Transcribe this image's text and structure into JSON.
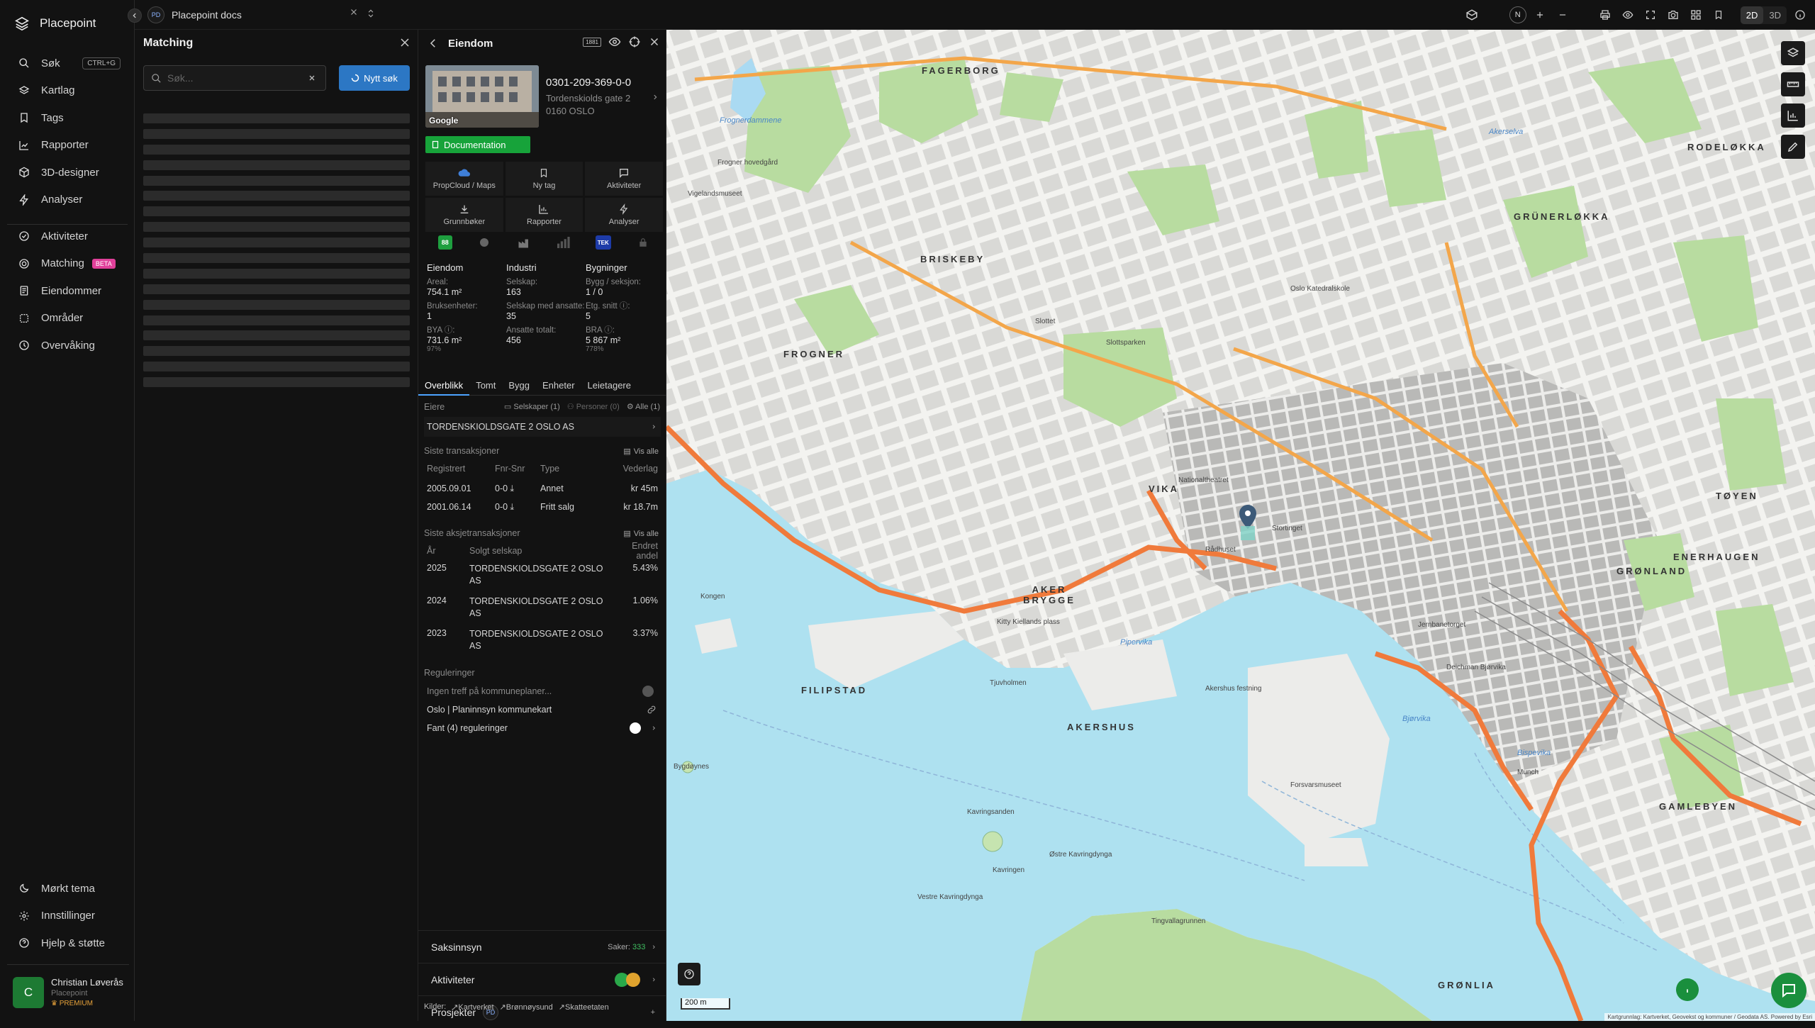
{
  "app": {
    "name": "Placepoint"
  },
  "sidebar": {
    "items_top": [
      {
        "label": "Søk",
        "shortcut": "CTRL+G"
      },
      {
        "label": "Kartlag"
      },
      {
        "label": "Tags"
      },
      {
        "label": "Rapporter"
      },
      {
        "label": "3D-designer"
      },
      {
        "label": "Analyser"
      }
    ],
    "items_mid": [
      {
        "label": "Aktiviteter"
      },
      {
        "label": "Matching",
        "badge": "BETA"
      },
      {
        "label": "Eiendommer"
      },
      {
        "label": "Områder"
      },
      {
        "label": "Overvåking"
      }
    ],
    "items_bottom": [
      {
        "label": "Mørkt tema"
      },
      {
        "label": "Innstillinger"
      },
      {
        "label": "Hjelp & støtte"
      }
    ],
    "user": {
      "initial": "C",
      "name": "Christian Løverås",
      "org": "Placepoint",
      "plan": "PREMIUM"
    }
  },
  "topbar": {
    "workspace_badge": "PD",
    "workspace_name": "Placepoint docs",
    "north": "N",
    "view_2d": "2D",
    "view_3d": "3D"
  },
  "matching": {
    "title": "Matching",
    "search_placeholder": "Søk...",
    "new_search_label": "Nytt søk"
  },
  "property": {
    "title": "Eiendom",
    "id": "0301-209-369-0-0",
    "address_line1": "Tordenskiolds gate 2",
    "address_line2": "0160 OSLO",
    "photo_credit": "Google",
    "documentation_label": "Documentation",
    "actions": [
      "PropCloud / Maps",
      "Ny tag",
      "Aktiviteter",
      "Grunnbøker",
      "Rapporter",
      "Analyser"
    ],
    "source_tek": "TEK",
    "source_88": "88",
    "stats": {
      "eiendom": {
        "heading": "Eiendom",
        "areal_label": "Areal:",
        "areal": "754.1 m²",
        "bruksenheter_label": "Bruksenheter:",
        "bruksenheter": "1",
        "bya_label": "BYA ⓘ:",
        "bya": "731.6 m²",
        "bya_pct": "97%"
      },
      "industri": {
        "heading": "Industri",
        "selskap_label": "Selskap:",
        "selskap": "163",
        "ansatte_label": "Selskap med ansatte:",
        "ansatte": "35",
        "ansatte_totalt_label": "Ansatte totalt:",
        "ansatte_totalt": "456"
      },
      "bygninger": {
        "heading": "Bygninger",
        "bygg_label": "Bygg / seksjon:",
        "bygg": "1 / 0",
        "etg_label": "Etg. snitt ⓘ:",
        "etg": "5",
        "bra_label": "BRA ⓘ:",
        "bra": "5 867 m²",
        "bra_pct": "778%"
      }
    },
    "tabs": [
      "Overblikk",
      "Tomt",
      "Bygg",
      "Enheter",
      "Leietagere"
    ],
    "owners": {
      "heading": "Eiere",
      "chip_selskaper": "Selskaper (1)",
      "chip_personer": "Personer (0)",
      "chip_alle": "Alle (1)",
      "owner": "TORDENSKIOLDSGATE 2 OSLO AS"
    },
    "transactions": {
      "heading": "Siste transaksjoner",
      "vis_alle": "Vis alle",
      "columns": [
        "Registrert",
        "Fnr-Snr",
        "Type",
        "Vederlag"
      ],
      "rows": [
        [
          "2005.09.01",
          "0-0",
          "Annet",
          "kr 45m"
        ],
        [
          "2001.06.14",
          "0-0",
          "Fritt salg",
          "kr 18.7m"
        ]
      ]
    },
    "share_transactions": {
      "heading": "Siste aksjetransaksjoner",
      "vis_alle": "Vis alle",
      "columns": [
        "År",
        "Solgt selskap",
        "Endret andel"
      ],
      "rows": [
        [
          "2025",
          "TORDENSKIOLDSGATE 2 OSLO AS",
          "5.43%"
        ],
        [
          "2024",
          "TORDENSKIOLDSGATE 2 OSLO AS",
          "1.06%"
        ],
        [
          "2023",
          "TORDENSKIOLDSGATE 2 OSLO AS",
          "3.37%"
        ]
      ]
    },
    "regulations": {
      "heading": "Reguleringer",
      "row1": "Ingen treff på kommuneplaner...",
      "row2": "Oslo | Planinnsyn kommunekart",
      "row3": "Fant (4) reguleringer"
    },
    "bottom": {
      "saksinnsyn": "Saksinnsyn",
      "saker_label": "Saker:",
      "saker_count": "333",
      "aktiviteter": "Aktiviteter",
      "prosjekter": "Prosjekter",
      "prosjekter_badge": "PD"
    },
    "sources": {
      "label": "Kilder:",
      "items": [
        "Kartverket",
        "Brønnøysund",
        "Skatteetaten"
      ]
    }
  },
  "map": {
    "scale": "200 m",
    "attribution": "Kartgrunnlag: Kartverket, Geovekst og kommuner / Geodata AS. Powered by Esri",
    "districts": [
      "FAGERBORG",
      "BRISKEBY",
      "FROGNER",
      "VIKA",
      "AKER BRYGGE",
      "FILIPSTAD",
      "AKERSHUS",
      "GRÜNERLØKKA",
      "TØYEN",
      "GRØNLAND",
      "ENERHAUGEN",
      "GAMLEBYEN",
      "RODELØKKA",
      "GRØNLIA"
    ],
    "places": [
      "Frognerdammene",
      "Frogner hovedgård",
      "Vigelandsmuseet",
      "Akerselva",
      "Slottsparken",
      "Oslo Katedralskole",
      "Nationaltheatret",
      "Rådhuset",
      "Stortinget",
      "Kavringen",
      "Kavringsanden",
      "Østre Kavringdynga",
      "Vestre Kavringdynga",
      "Tingvallagrunnen",
      "Pipervika",
      "Bjørvika",
      "Bispevika",
      "Bygdøynes",
      "Kongen",
      "Akershus festning",
      "Munch",
      "Slottet",
      "Tjuvholmen",
      "Kitty Kiellands plass",
      "Forsvarsmuseet",
      "Deichman Bjørvika",
      "Jernbanetorget"
    ]
  },
  "colors": {
    "accent": "#2c77c4",
    "green": "#17a33a",
    "beta": "#e0409a",
    "premium": "#e7a23a"
  }
}
